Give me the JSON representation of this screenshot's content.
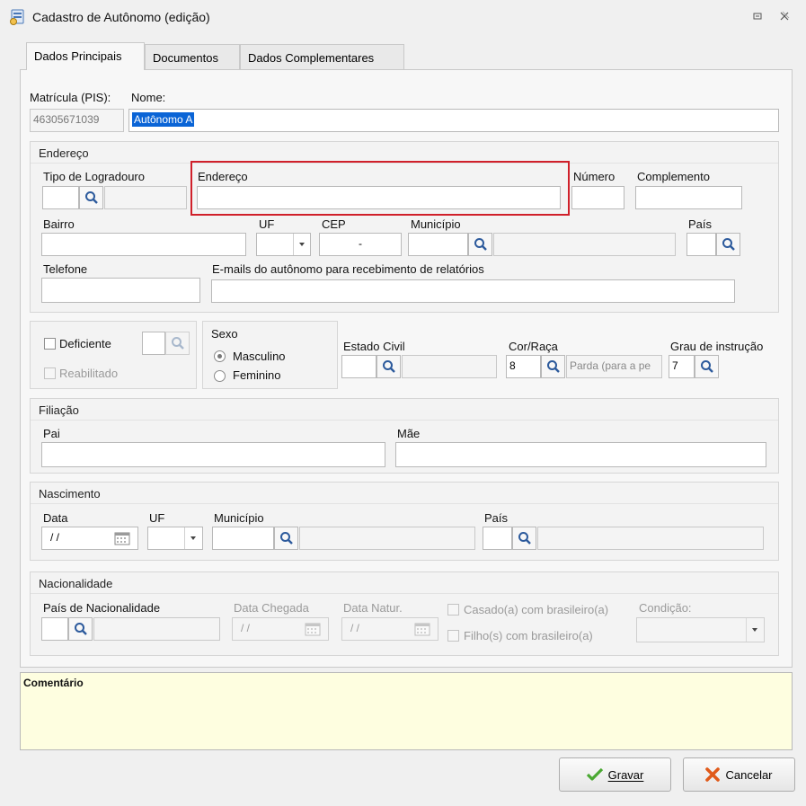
{
  "window": {
    "title": "Cadastro de Autônomo (edição)",
    "controls": [
      "restore-icon",
      "close-icon"
    ]
  },
  "tabs": [
    {
      "label": "Dados Principais"
    },
    {
      "label": "Documentos"
    },
    {
      "label": "Dados Complementares"
    }
  ],
  "identity": {
    "matricula_label": "Matrícula (PIS):",
    "matricula_value": "46305671039",
    "nome_label": "Nome:",
    "nome_value": "Autônomo A"
  },
  "endereco": {
    "section_title": "Endereço",
    "tipo_logradouro_label": "Tipo de Logradouro",
    "endereco_label": "Endereço",
    "endereco_value": "",
    "numero_label": "Número",
    "complemento_label": "Complemento",
    "bairro_label": "Bairro",
    "uf_label": "UF",
    "cep_label": "CEP",
    "cep_value": "-",
    "municipio_label": "Município",
    "pais_label": "País",
    "telefone_label": "Telefone",
    "emails_label": "E-mails do autônomo para recebimento de relatórios",
    "highlight_color": "#d0202a"
  },
  "deficiente": {
    "deficiente_label": "Deficiente",
    "reabilitado_label": "Reabilitado"
  },
  "sexo": {
    "title": "Sexo",
    "masculino_label": "Masculino",
    "feminino_label": "Feminino",
    "selected": "Masculino"
  },
  "estado_civil": {
    "label": "Estado Civil"
  },
  "cor_raca": {
    "label": "Cor/Raça",
    "code": "8",
    "description": "Parda (para a pe"
  },
  "grau_instrucao": {
    "label": "Grau de instrução",
    "code": "7"
  },
  "filiacao": {
    "section_title": "Filiação",
    "pai_label": "Pai",
    "mae_label": "Mãe"
  },
  "nascimento": {
    "section_title": "Nascimento",
    "data_label": "Data",
    "data_value": "/ /",
    "uf_label": "UF",
    "municipio_label": "Município",
    "pais_label": "País"
  },
  "nacionalidade": {
    "section_title": "Nacionalidade",
    "pais_label": "País de Nacionalidade",
    "data_chegada_label": "Data Chegada",
    "data_chegada_value": "/ /",
    "data_natur_label": "Data Natur.",
    "data_natur_value": "/ /",
    "casado_label": "Casado(a) com brasileiro(a)",
    "filho_label": "Filho(s) com brasileiro(a)",
    "condicao_label": "Condição:"
  },
  "comentario": {
    "label": "Comentário",
    "background": "#fefee0"
  },
  "actions": {
    "gravar_label": "Gravar",
    "cancelar_label": "Cancelar"
  },
  "colors": {
    "selection": "#0a64d6",
    "check_green": "#4aa832",
    "cancel_orange": "#e05a1a"
  }
}
